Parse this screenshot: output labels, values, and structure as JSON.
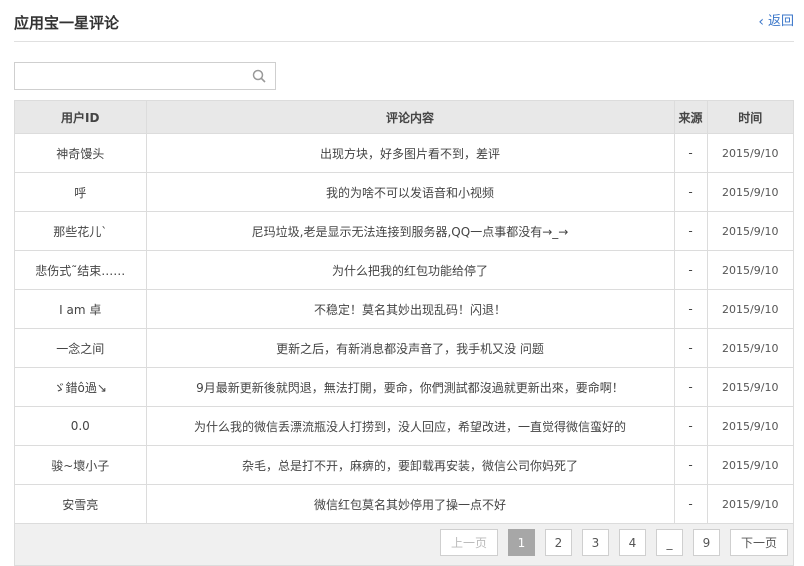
{
  "header": {
    "title": "应用宝一星评论",
    "back_label": "返回"
  },
  "search": {
    "value": "",
    "placeholder": ""
  },
  "table": {
    "columns": [
      "用户ID",
      "评论内容",
      "来源",
      "时间"
    ],
    "rows": [
      {
        "user": "神奇馒头",
        "comment": "出现方块，好多图片看不到，差评",
        "source": "-",
        "date": "2015/9/10"
      },
      {
        "user": "呼",
        "comment": "我的为啥不可以发语音和小视频",
        "source": "-",
        "date": "2015/9/10"
      },
      {
        "user": "那些花儿`",
        "comment": "尼玛垃圾,老是显示无法连接到服务器,QQ一点事都没有→_→",
        "source": "-",
        "date": "2015/9/10"
      },
      {
        "user": "悲伤式˜结束……",
        "comment": "为什么把我的红包功能给停了",
        "source": "-",
        "date": "2015/9/10"
      },
      {
        "user": "I am 卓",
        "comment": "不稳定！莫名其妙出现乱码！闪退！",
        "source": "-",
        "date": "2015/9/10"
      },
      {
        "user": "一念之间",
        "comment": "更新之后，有新消息都没声音了，我手机又没 问题",
        "source": "-",
        "date": "2015/9/10"
      },
      {
        "user": "ゞ錯ô過↘",
        "comment": "9月最新更新後就閃退，無法打開，要命，你們測試都沒過就更新出來，要命啊！",
        "source": "-",
        "date": "2015/9/10"
      },
      {
        "user": "0.0",
        "comment": "为什么我的微信丢漂流瓶没人打捞到，没人回应，希望改进，一直觉得微信蛮好的",
        "source": "-",
        "date": "2015/9/10"
      },
      {
        "user": "骏~壞小子",
        "comment": "杂毛，总是打不开，麻痹的，要卸载再安装，微信公司你妈死了",
        "source": "-",
        "date": "2015/9/10"
      },
      {
        "user": "安雪亮",
        "comment": "微信红包莫名其妙停用了操一点不好",
        "source": "-",
        "date": "2015/9/10"
      }
    ]
  },
  "pagination": {
    "prev_label": "上一页",
    "next_label": "下一页",
    "pages": [
      "1",
      "2",
      "3",
      "4",
      "_",
      "9"
    ],
    "active_page": "1"
  },
  "colors": {
    "accent_link": "#3a76c9",
    "header_bg": "#e8e8e8",
    "active_page_bg": "#a7a7a7"
  },
  "icons": {
    "search": "search-icon",
    "back": "chevron-left-icon"
  }
}
